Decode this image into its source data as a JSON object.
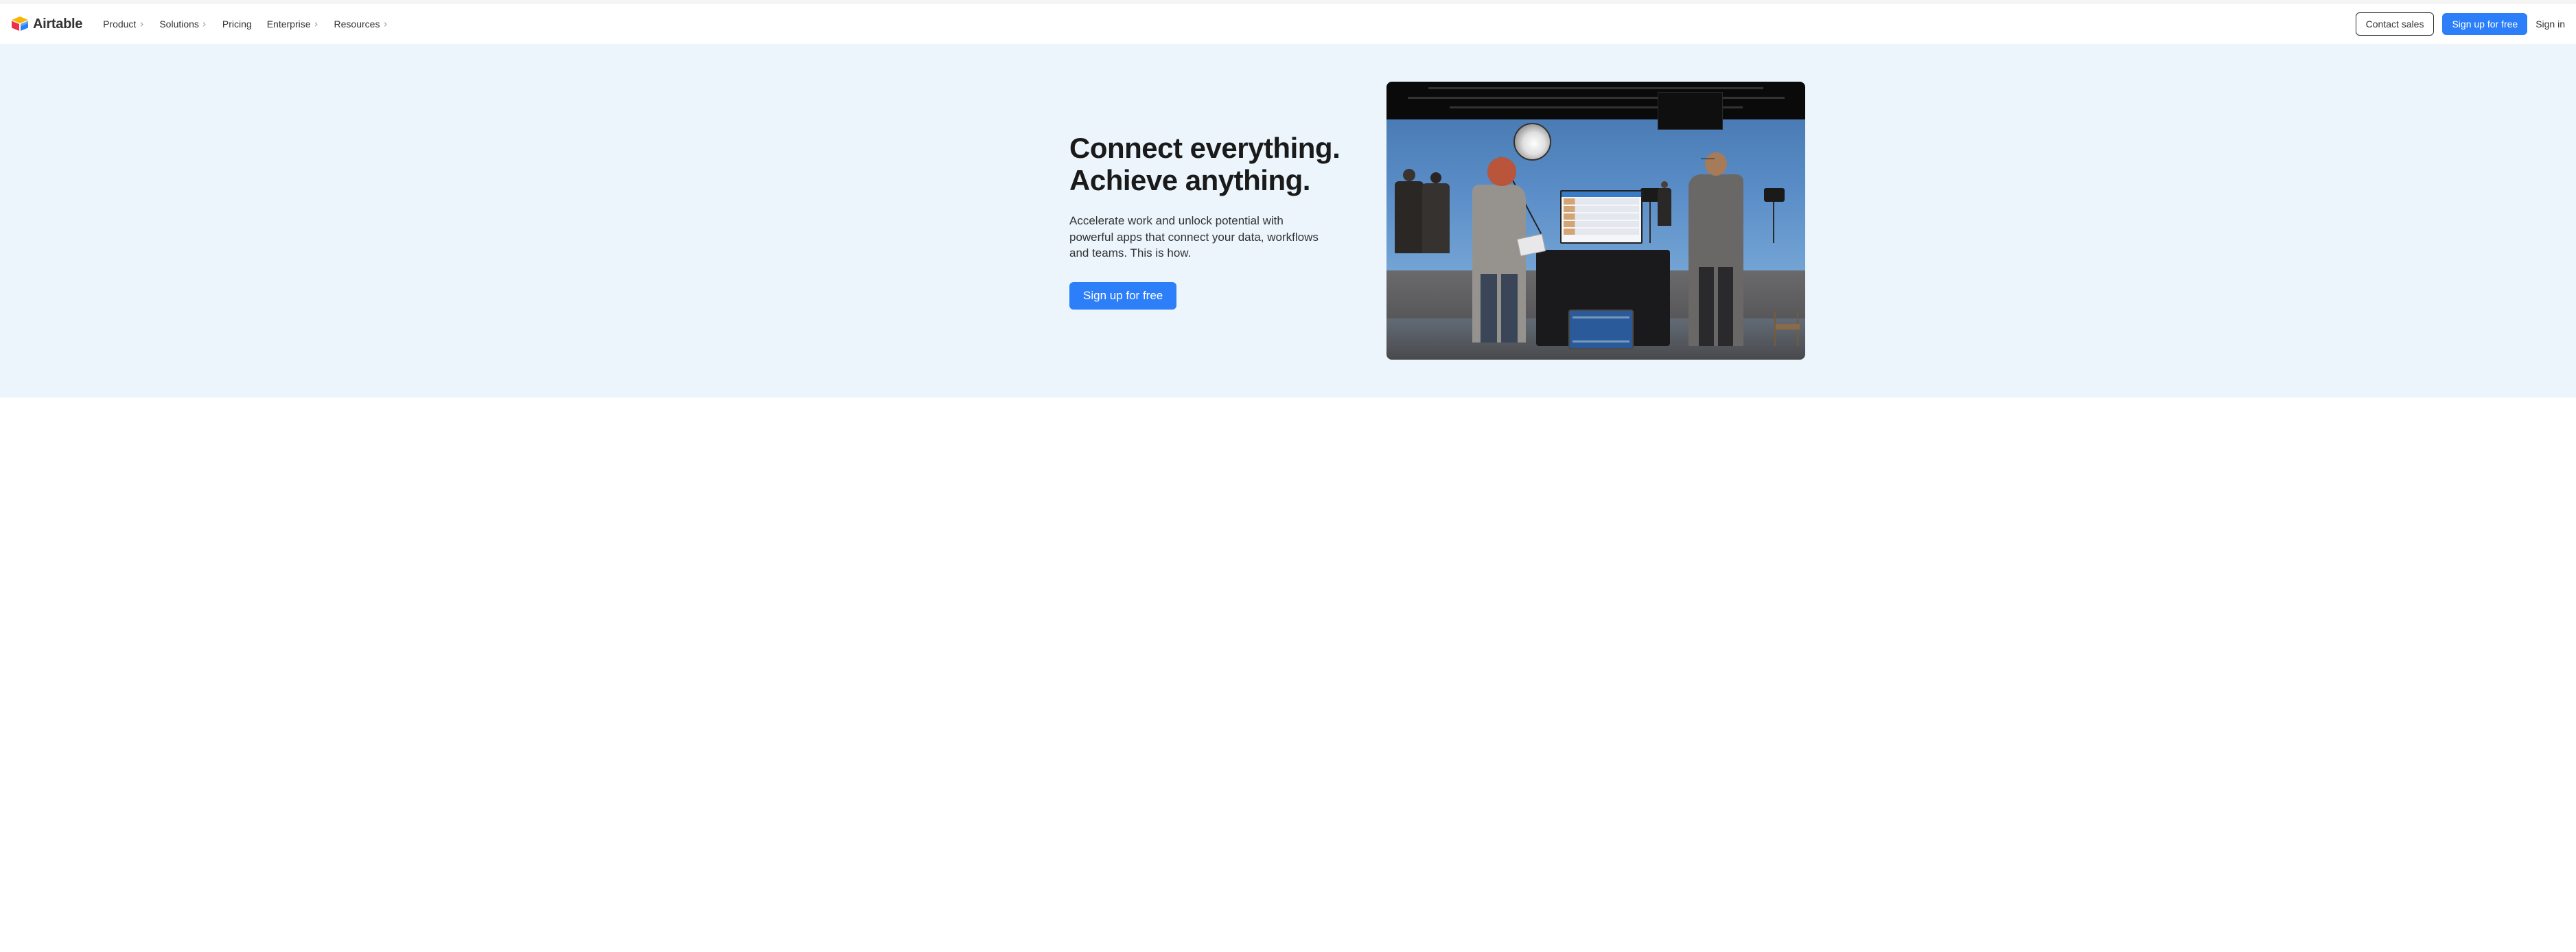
{
  "brand": {
    "name": "Airtable"
  },
  "nav": {
    "items": [
      {
        "label": "Product",
        "has_submenu": true
      },
      {
        "label": "Solutions",
        "has_submenu": true
      },
      {
        "label": "Pricing",
        "has_submenu": false
      },
      {
        "label": "Enterprise",
        "has_submenu": true
      },
      {
        "label": "Resources",
        "has_submenu": true
      }
    ]
  },
  "header_actions": {
    "contact_sales": "Contact sales",
    "signup": "Sign up for free",
    "signin": "Sign in"
  },
  "hero": {
    "headline": "Connect everything. Achieve anything.",
    "subheadline": "Accelerate work and unlock potential with powerful apps that connect your data, workflows and teams. This is how.",
    "cta": "Sign up for free",
    "image_alt": "Film studio production set with people using Airtable on a monitor"
  },
  "colors": {
    "primary": "#2d7ff9",
    "hero_bg": "#ebf5fb"
  }
}
